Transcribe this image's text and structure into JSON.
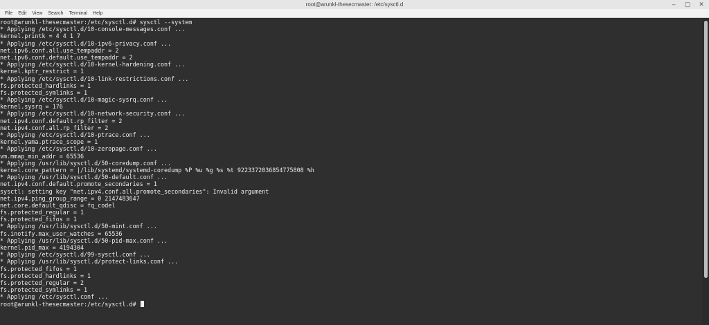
{
  "window": {
    "title": "root@arunkl-thesecmaster: /etc/sysctl.d",
    "controls": {
      "minimize": "–",
      "maximize": "▢",
      "close": "✕"
    }
  },
  "menubar": {
    "items": [
      "File",
      "Edit",
      "View",
      "Search",
      "Terminal",
      "Help"
    ]
  },
  "terminal": {
    "lines": [
      "root@arunkl-thesecmaster:/etc/sysctl.d# sysctl --system",
      "* Applying /etc/sysctl.d/10-console-messages.conf ...",
      "kernel.printk = 4 4 1 7",
      "* Applying /etc/sysctl.d/10-ipv6-privacy.conf ...",
      "net.ipv6.conf.all.use_tempaddr = 2",
      "net.ipv6.conf.default.use_tempaddr = 2",
      "* Applying /etc/sysctl.d/10-kernel-hardening.conf ...",
      "kernel.kptr_restrict = 1",
      "* Applying /etc/sysctl.d/10-link-restrictions.conf ...",
      "fs.protected_hardlinks = 1",
      "fs.protected_symlinks = 1",
      "* Applying /etc/sysctl.d/10-magic-sysrq.conf ...",
      "kernel.sysrq = 176",
      "* Applying /etc/sysctl.d/10-network-security.conf ...",
      "net.ipv4.conf.default.rp_filter = 2",
      "net.ipv4.conf.all.rp_filter = 2",
      "* Applying /etc/sysctl.d/10-ptrace.conf ...",
      "kernel.yama.ptrace_scope = 1",
      "* Applying /etc/sysctl.d/10-zeropage.conf ...",
      "vm.mmap_min_addr = 65536",
      "* Applying /usr/lib/sysctl.d/50-coredump.conf ...",
      "kernel.core_pattern = |/lib/systemd/systemd-coredump %P %u %g %s %t 9223372036854775808 %h",
      "* Applying /usr/lib/sysctl.d/50-default.conf ...",
      "net.ipv4.conf.default.promote_secondaries = 1",
      "sysctl: setting key \"net.ipv4.conf.all.promote_secondaries\": Invalid argument",
      "net.ipv4.ping_group_range = 0 2147483647",
      "net.core.default_qdisc = fq_codel",
      "fs.protected_regular = 1",
      "fs.protected_fifos = 1",
      "* Applying /usr/lib/sysctl.d/50-mint.conf ...",
      "fs.inotify.max_user_watches = 65536",
      "* Applying /usr/lib/sysctl.d/50-pid-max.conf ...",
      "kernel.pid_max = 4194304",
      "* Applying /etc/sysctl.d/99-sysctl.conf ...",
      "* Applying /usr/lib/sysctl.d/protect-links.conf ...",
      "fs.protected_fifos = 1",
      "fs.protected_hardlinks = 1",
      "fs.protected_regular = 2",
      "fs.protected_symlinks = 1",
      "* Applying /etc/sysctl.conf ...",
      "root@arunkl-thesecmaster:/etc/sysctl.d# "
    ]
  },
  "colors": {
    "terminal_bg": "#2f2f2f",
    "terminal_fg": "#ececec",
    "titlebar_bg": "#e6e6e6",
    "menubar_bg": "#f2f2f2"
  }
}
